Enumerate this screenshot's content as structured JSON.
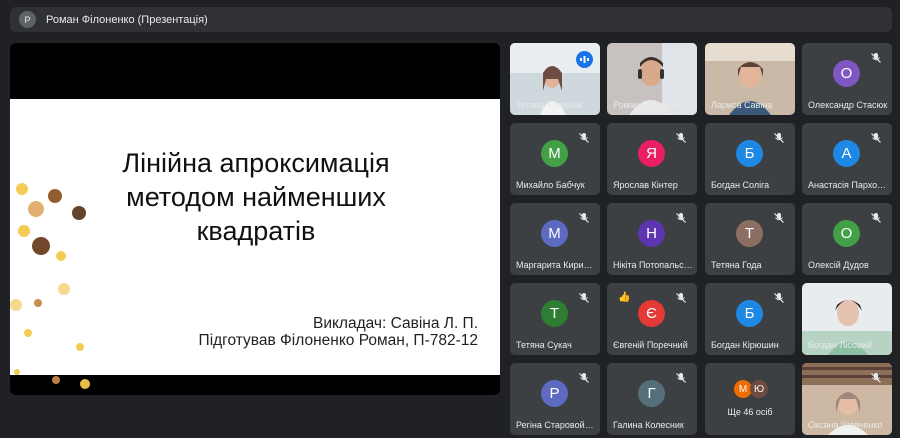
{
  "header": {
    "avatar_letter": "Р",
    "title": "Роман Філоненко (Презентація)"
  },
  "slide": {
    "title_lines": [
      "Лінійна апроксимація",
      "методом найменших",
      "квадратів"
    ],
    "teacher": "Викладач: Савіна Л. П.",
    "prepared": "Підготував Філоненко Роман, П-782-12"
  },
  "tiles": [
    {
      "name": "Тетяна Куринна",
      "video": true,
      "speaking": true
    },
    {
      "name": "Роман Філоненко",
      "video": true
    },
    {
      "name": "Лариса Савіна",
      "video": true
    },
    {
      "name": "Олександр Стасюк",
      "letter": "О",
      "color": "#7e57c2",
      "muted": true
    },
    {
      "name": "Михайло Бабчук",
      "letter": "М",
      "color": "#43a047",
      "muted": true
    },
    {
      "name": "Ярослав Кінтер",
      "letter": "Я",
      "color": "#e91e63",
      "muted": true
    },
    {
      "name": "Богдан Соліга",
      "letter": "Б",
      "color": "#1e88e5",
      "muted": true
    },
    {
      "name": "Анастасія Пархоменко",
      "letter": "А",
      "color": "#1e88e5",
      "muted": true
    },
    {
      "name": "Маргарита Кирилюк",
      "letter": "М",
      "color": "#5c6bc0",
      "muted": true
    },
    {
      "name": "Нікіта Потопальський",
      "letter": "Н",
      "color": "#5e35b1",
      "muted": true
    },
    {
      "name": "Тетяна Года",
      "letter": "Т",
      "color": "#8d6e63",
      "muted": true
    },
    {
      "name": "Олексій Дудов",
      "letter": "О",
      "color": "#43a047",
      "muted": true
    },
    {
      "name": "Тетяна Сукач",
      "letter": "Т",
      "color": "#2e7d32",
      "muted": true
    },
    {
      "name": "Євгеній Поречний",
      "letter": "Є",
      "color": "#e53935",
      "muted": true,
      "reaction": "👍"
    },
    {
      "name": "Богдан Кірюшин",
      "letter": "Б",
      "color": "#1e88e5",
      "muted": true
    },
    {
      "name": "Богдан Лісовий",
      "video": true,
      "muted": true
    },
    {
      "name": "Регіна Старовойтова",
      "letter": "Р",
      "color": "#5c6bc0",
      "muted": true
    },
    {
      "name": "Галина Колесник",
      "letter": "Г",
      "color": "#546e7a",
      "muted": true
    },
    {
      "name": "",
      "more": true,
      "more_text": "Ще 46 осіб",
      "more_letters": [
        "М",
        "Ю"
      ]
    },
    {
      "name": "Оксана Шевченко",
      "video": true,
      "muted": true
    }
  ]
}
